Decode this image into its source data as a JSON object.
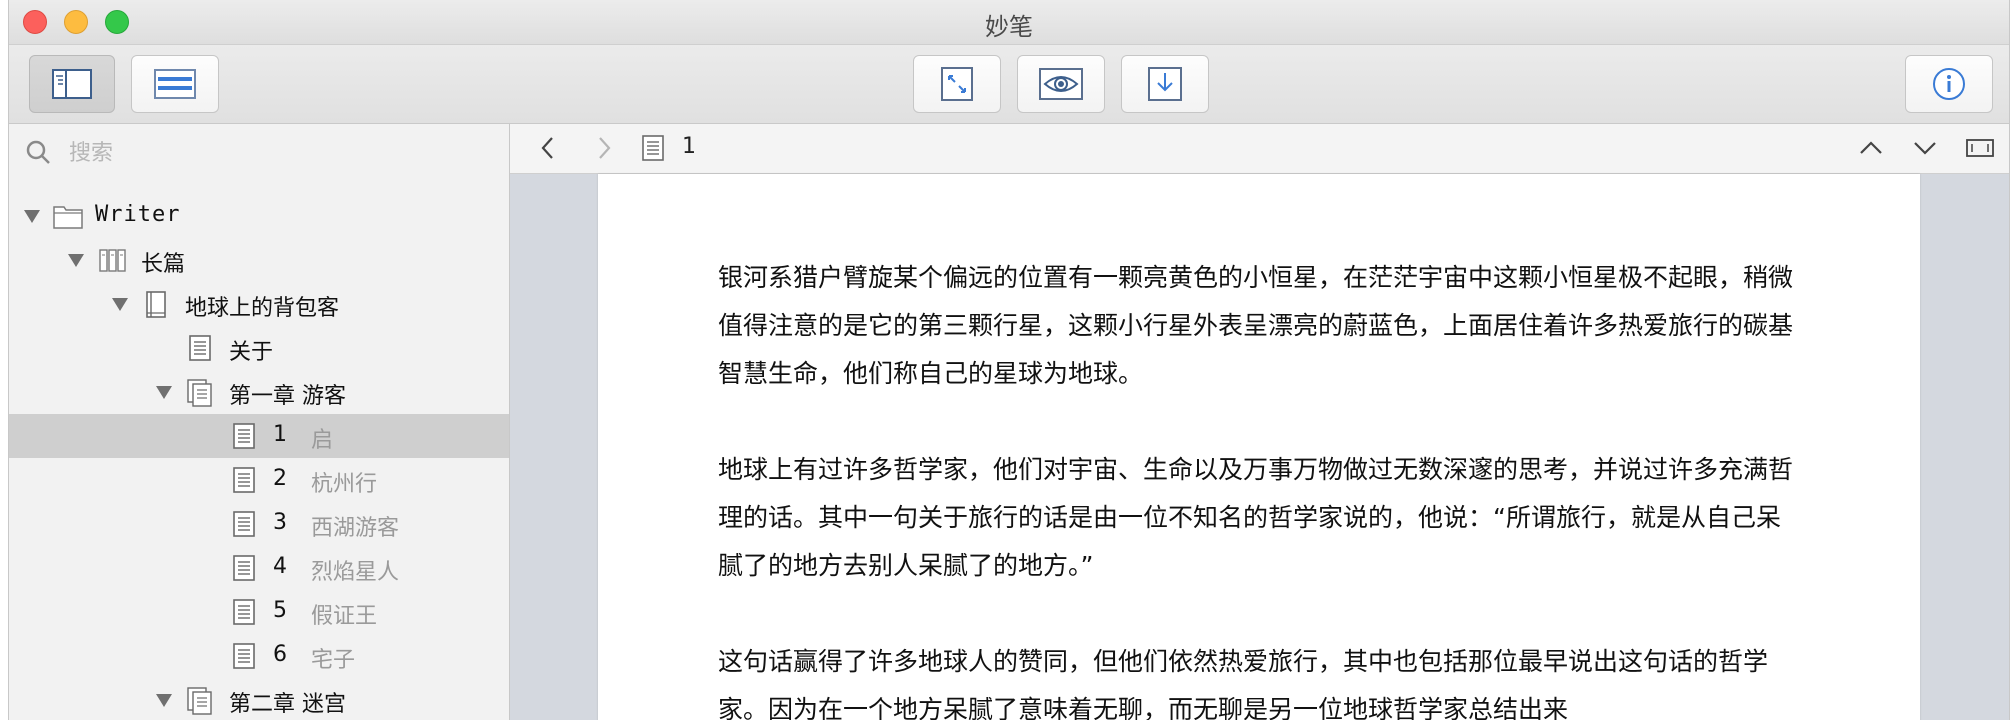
{
  "window": {
    "title": "妙笔"
  },
  "search": {
    "placeholder": "搜索"
  },
  "tree": {
    "root": "Writer",
    "longform": "长篇",
    "book": "地球上的背包客",
    "about": "关于",
    "chapter1": {
      "label": "第一章  游客"
    },
    "docs": [
      {
        "num": "1",
        "title": "启"
      },
      {
        "num": "2",
        "title": "杭州行"
      },
      {
        "num": "3",
        "title": "西湖游客"
      },
      {
        "num": "4",
        "title": "烈焰星人"
      },
      {
        "num": "5",
        "title": "假证王"
      },
      {
        "num": "6",
        "title": "宅子"
      }
    ],
    "chapter2": {
      "label": "第二章  迷宫"
    }
  },
  "nav": {
    "current_doc": "1"
  },
  "document": {
    "paragraphs": [
      "银河系猎户臂旋某个偏远的位置有一颗亮黄色的小恒星，在茫茫宇宙中这颗小恒星极不起眼，稍微值得注意的是它的第三颗行星，这颗小行星外表呈漂亮的蔚蓝色，上面居住着许多热爱旅行的碳基智慧生命，他们称自己的星球为地球。",
      "地球上有过许多哲学家，他们对宇宙、生命以及万事万物做过无数深邃的思考，并说过许多充满哲理的话。其中一句关于旅行的话是由一位不知名的哲学家说的，他说：“所谓旅行，就是从自己呆腻了的地方去别人呆腻了的地方。”",
      "这句话赢得了许多地球人的赞同，但他们依然热爱旅行，其中也包括那位最早说出这句话的哲学家。因为在一个地方呆腻了意味着无聊，而无聊是另一位地球哲学家总结出来"
    ]
  },
  "colors": {
    "selection": "#cfcfcf",
    "accent_blue": "#3a7bd5",
    "editor_bg": "#d4d8df"
  }
}
